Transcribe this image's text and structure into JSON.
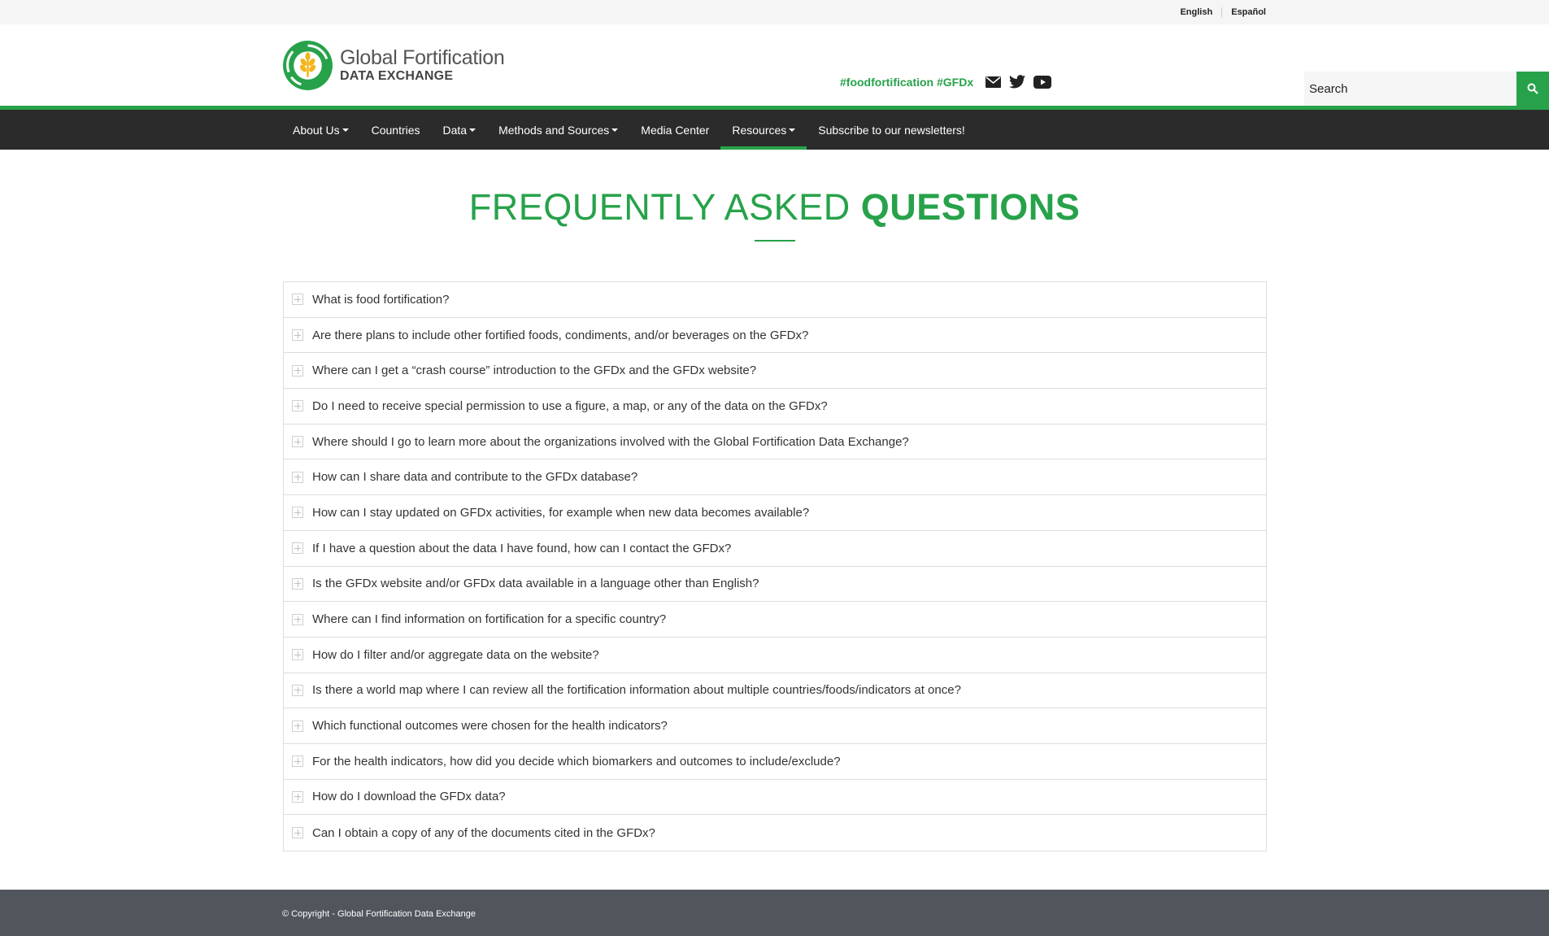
{
  "language_bar": {
    "english": "English",
    "spanish": "Español"
  },
  "logo": {
    "line1": "Global Fortification",
    "line2": "DATA EXCHANGE",
    "colors": {
      "green": "#27a24a",
      "yellow": "#f2b51d"
    }
  },
  "social": {
    "hashtags": "#foodfortification #GFDx",
    "icons": [
      "email-icon",
      "twitter-icon",
      "youtube-icon"
    ]
  },
  "search": {
    "placeholder": "Search",
    "value": ""
  },
  "nav": {
    "items": [
      {
        "label": "About Us",
        "dropdown": true
      },
      {
        "label": "Countries",
        "dropdown": false
      },
      {
        "label": "Data",
        "dropdown": true
      },
      {
        "label": "Methods and Sources",
        "dropdown": true
      },
      {
        "label": "Media Center",
        "dropdown": false
      },
      {
        "label": "Resources",
        "dropdown": true,
        "active": true
      },
      {
        "label": "Subscribe to our newsletters!",
        "dropdown": false
      }
    ]
  },
  "page": {
    "title_thin": "FREQUENTLY ASKED",
    "title_bold": "QUESTIONS"
  },
  "faq": [
    "What is food fortification?",
    "Are there plans to include other fortified foods, condiments, and/or beverages on the GFDx?",
    "Where can I get a “crash course” introduction to the GFDx and the GFDx website?",
    "Do I need to receive special permission to use a figure, a map, or any of the data on the GFDx?",
    "Where should I go to learn more about the organizations involved with the Global Fortification Data Exchange?",
    "How can I share data and contribute to the GFDx database?",
    "How can I stay updated on GFDx activities, for example when new data becomes available?",
    "If I have a question about the data I have found, how can I contact the GFDx?",
    "Is the GFDx website and/or GFDx data available in a language other than English?",
    "Where can I find information on fortification for a specific country?",
    "How do I filter and/or aggregate data on the website?",
    "Is there a world map where I can review all the fortification information about multiple countries/foods/indicators at once?",
    "Which functional outcomes were chosen for the health indicators?",
    "For the health indicators, how did you decide which biomarkers and outcomes to include/exclude?",
    "How do I download the GFDx data?",
    "Can I obtain a copy of any of the documents cited in the GFDx?"
  ],
  "footer": {
    "copyright": "© Copyright - Global Fortification Data Exchange"
  },
  "colors": {
    "accent": "#27a24a",
    "nav_bg": "#2b2b2b",
    "footer_bg": "#50565c"
  }
}
